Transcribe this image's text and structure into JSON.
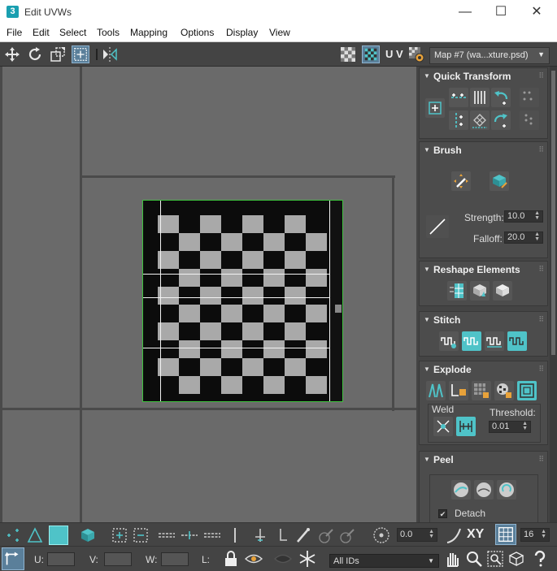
{
  "window": {
    "app_icon": "3",
    "title": "Edit UVWs",
    "minimize": "—",
    "maximize": "☐",
    "close": "✕"
  },
  "menu": [
    "File",
    "Edit",
    "Select",
    "Tools",
    "Mapping",
    "Options",
    "Display",
    "View"
  ],
  "toolbar": {
    "uv_label": "U V",
    "map_select": "Map #7 (wa...xture.psd)"
  },
  "rollouts": {
    "quick_transform": {
      "title": "Quick Transform"
    },
    "brush": {
      "title": "Brush",
      "strength_label": "Strength:",
      "strength_value": "10.0",
      "falloff_label": "Falloff:",
      "falloff_value": "20.0"
    },
    "reshape": {
      "title": "Reshape Elements"
    },
    "stitch": {
      "title": "Stitch"
    },
    "explode": {
      "title": "Explode",
      "weld_label": "Weld",
      "threshold_label": "Threshold:",
      "threshold_value": "0.01"
    },
    "peel": {
      "title": "Peel",
      "detach_label": "Detach",
      "detach_checked": true
    }
  },
  "bottom": {
    "offset_value": "0.0",
    "xy_label": "XY",
    "grid_value": "16",
    "u_label": "U:",
    "v_label": "V:",
    "w_label": "W:",
    "l_label": "L:",
    "ids_select": "All IDs"
  },
  "colors": {
    "accent": "#4fc3c8",
    "selection": "#3ec23e",
    "viewport": "#6a6a6a"
  }
}
